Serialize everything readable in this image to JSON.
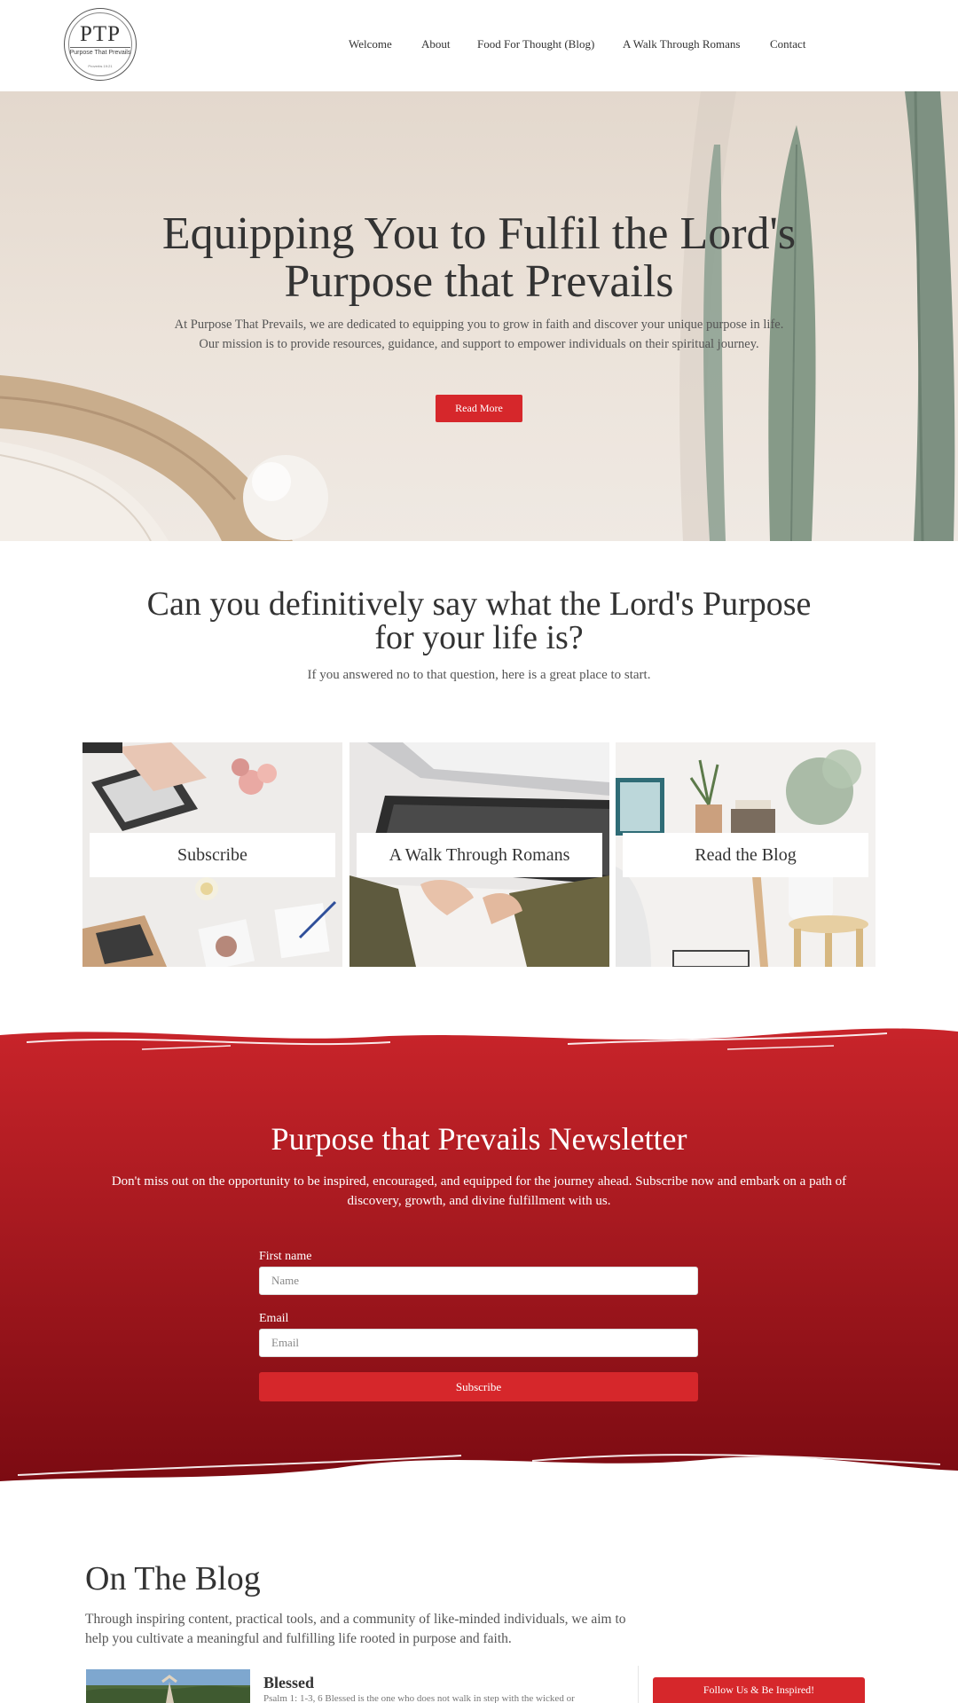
{
  "header": {
    "logo": {
      "initials": "PTP",
      "subtitle": "Purpose That Prevails",
      "small_text": "Proverbs 19:21"
    },
    "nav": [
      {
        "label": "Welcome"
      },
      {
        "label": "About"
      },
      {
        "label": "Food For Thought (Blog)"
      },
      {
        "label": "A Walk Through Romans"
      },
      {
        "label": "Contact"
      }
    ]
  },
  "hero": {
    "title": "Equipping You to Fulfil the Lord's Purpose that Prevails",
    "text": "At Purpose That Prevails, we are dedicated to equipping you to grow in faith and discover your unique purpose in life. Our mission is to provide resources, guidance, and support to empower individuals on their spiritual journey.",
    "button_label": "Read More"
  },
  "question": {
    "title": "Can you definitively say what the Lord's Purpose for your life is?",
    "subtitle": "If you answered no to that question, here is a great place to start."
  },
  "cards": [
    {
      "label": "Subscribe"
    },
    {
      "label": "A Walk Through Romans"
    },
    {
      "label": "Read the Blog"
    }
  ],
  "newsletter": {
    "title": "Purpose that Prevails Newsletter",
    "text": "Don't miss out on the opportunity to be inspired, encouraged, and equipped for the journey ahead. Subscribe now and embark on a path of discovery, growth, and divine fulfillment with us.",
    "first_name_label": "First name",
    "first_name_placeholder": "Name",
    "email_label": "Email",
    "email_placeholder": "Email",
    "button_label": "Subscribe"
  },
  "blog": {
    "title": "On The Blog",
    "text": "Through inspiring content, practical tools, and a community of like-minded individuals, we aim to help you cultivate a meaningful and fulfilling life rooted in purpose and faith.",
    "post": {
      "title": "Blessed",
      "excerpt": "Psalm 1: 1-3, 6 Blessed is the one who does not walk in step with the wicked or"
    },
    "follow_button": "Follow Us & Be Inspired!"
  },
  "colors": {
    "accent": "#d6272b",
    "newsletter_top": "#c8242a",
    "newsletter_bottom": "#7c0b12",
    "text": "#333333"
  }
}
